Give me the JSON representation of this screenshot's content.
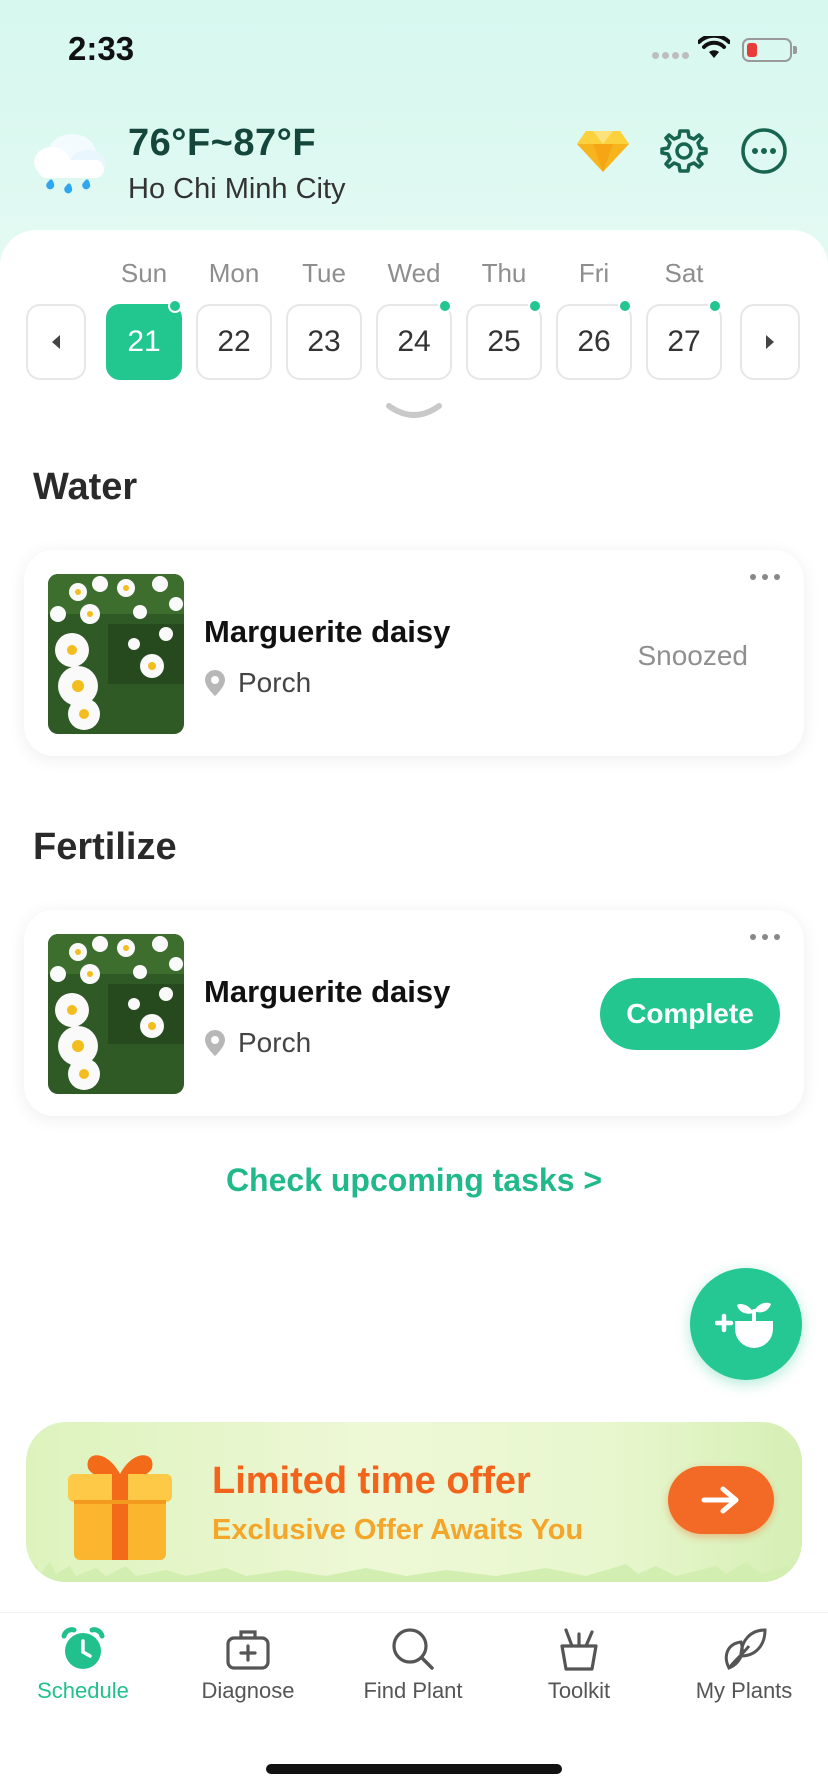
{
  "status_bar": {
    "time": "2:33"
  },
  "header": {
    "temperature": "76°F~87°F",
    "city": "Ho Chi Minh City",
    "icons": [
      "rain-cloud-icon",
      "premium-gem-icon",
      "settings-gear-icon",
      "more-options-icon"
    ]
  },
  "calendar": {
    "days": [
      {
        "name": "Sun",
        "date": "21",
        "selected": true,
        "has_task": true
      },
      {
        "name": "Mon",
        "date": "22",
        "selected": false,
        "has_task": false
      },
      {
        "name": "Tue",
        "date": "23",
        "selected": false,
        "has_task": false
      },
      {
        "name": "Wed",
        "date": "24",
        "selected": false,
        "has_task": true
      },
      {
        "name": "Thu",
        "date": "25",
        "selected": false,
        "has_task": true
      },
      {
        "name": "Fri",
        "date": "26",
        "selected": false,
        "has_task": true
      },
      {
        "name": "Sat",
        "date": "27",
        "selected": false,
        "has_task": true
      }
    ],
    "accent": "#22c790"
  },
  "sections": {
    "water": {
      "title": "Water",
      "plant_name": "Marguerite daisy",
      "location": "Porch",
      "status": "Snoozed"
    },
    "fertilize": {
      "title": "Fertilize",
      "plant_name": "Marguerite daisy",
      "location": "Porch",
      "action": "Complete"
    }
  },
  "upcoming_link": "Check upcoming tasks >",
  "offer": {
    "title": "Limited time offer",
    "subtitle": "Exclusive Offer Awaits You",
    "title_color": "#f2641c",
    "subtitle_color": "#f4a62a"
  },
  "tabs": {
    "schedule": "Schedule",
    "diagnose": "Diagnose",
    "find_plant": "Find Plant",
    "toolkit": "Toolkit",
    "my_plants": "My Plants",
    "active": "Schedule"
  }
}
